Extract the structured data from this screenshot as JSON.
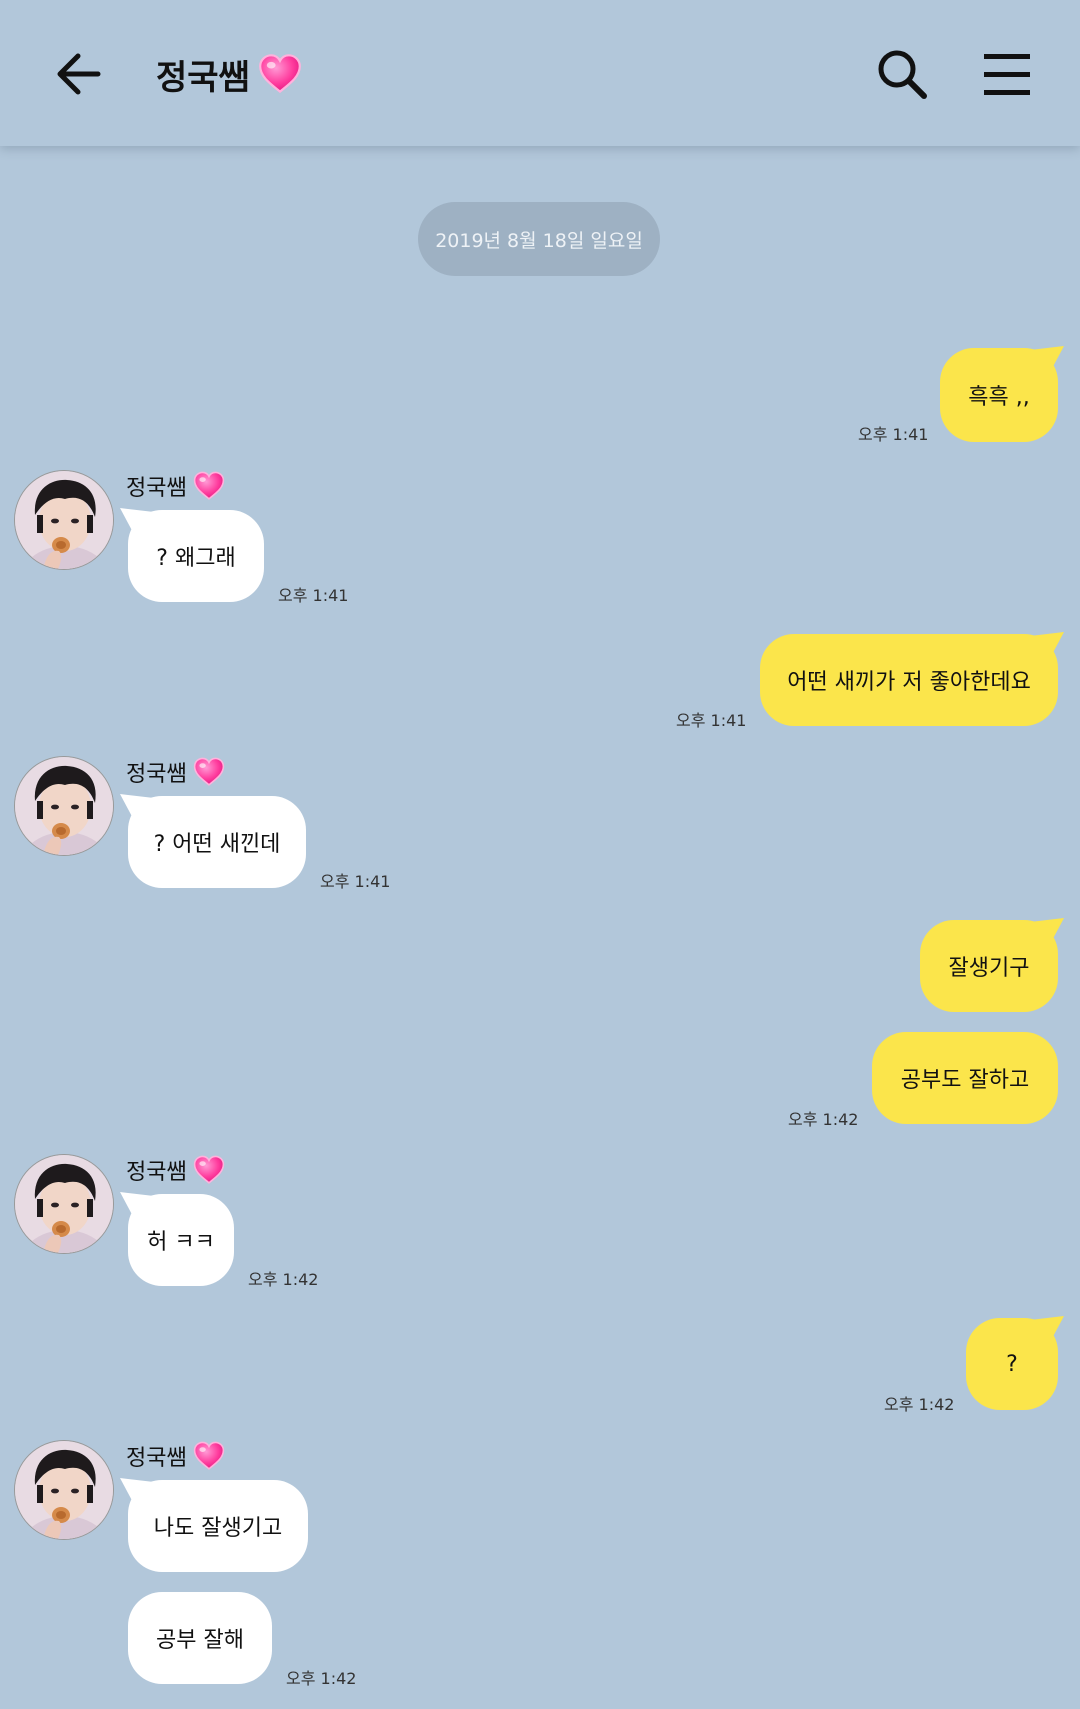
{
  "header": {
    "title": "정국쌤",
    "title_emoji": "heart-emoji"
  },
  "date_separator": "2019년 8월 18일 일요일",
  "contact": {
    "name": "정국쌤"
  },
  "messages": [
    {
      "from": "me",
      "text": "흑흑 ,,",
      "time": "오후 1:41"
    },
    {
      "from": "them",
      "text": "? 왜그래",
      "time": "오후 1:41"
    },
    {
      "from": "me",
      "text": "어떤 새끼가 저 좋아한데요",
      "time": "오후 1:41"
    },
    {
      "from": "them",
      "text": "? 어떤 새낀데",
      "time": "오후 1:41"
    },
    {
      "from": "me",
      "text": "잘생기구",
      "time": ""
    },
    {
      "from": "me",
      "text": "공부도 잘하고",
      "time": "오후 1:42"
    },
    {
      "from": "them",
      "text": "허 ㅋㅋ",
      "time": "오후 1:42"
    },
    {
      "from": "me",
      "text": "?",
      "time": "오후 1:42"
    },
    {
      "from": "them",
      "text": "나도 잘생기고",
      "time": ""
    },
    {
      "from": "them",
      "text": "공부 잘해",
      "time": "오후 1:42"
    }
  ],
  "colors": {
    "background": "#b2c7da",
    "my_bubble": "#fbe54b",
    "their_bubble": "#ffffff",
    "heart": "#ff4fa8"
  },
  "icons": {
    "back": "arrow-left-icon",
    "search": "search-icon",
    "menu": "hamburger-menu-icon"
  }
}
